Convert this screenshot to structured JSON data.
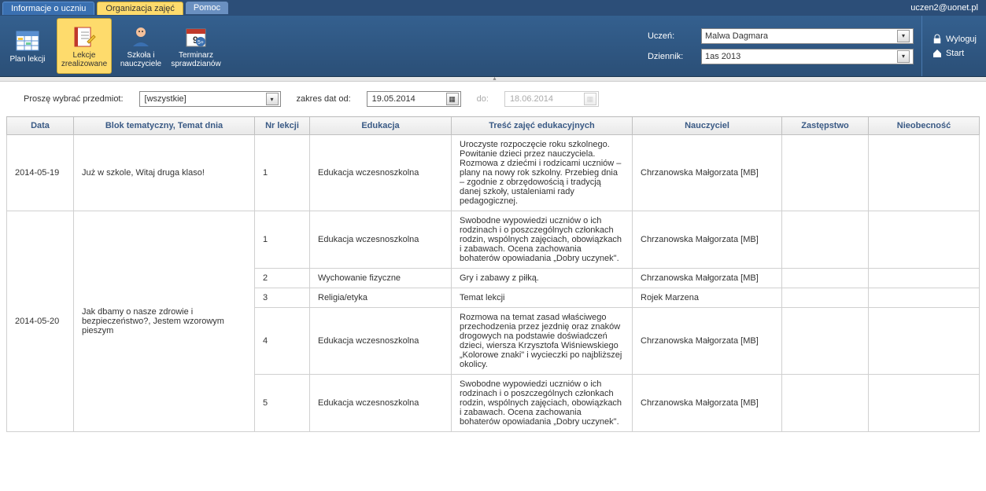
{
  "header": {
    "tabs": [
      "Informacje o uczniu",
      "Organizacja zajęć",
      "Pomoc"
    ],
    "user_email": "uczen2@uonet.pl"
  },
  "ribbon": {
    "buttons": [
      {
        "label": "Plan lekcji"
      },
      {
        "label": "Lekcje zrealizowane"
      },
      {
        "label": "Szkoła i nauczyciele"
      },
      {
        "label": "Terminarz sprawdzianów"
      }
    ],
    "uczen_label": "Uczeń:",
    "uczen_value": "Malwa Dagmara",
    "dziennik_label": "Dziennik:",
    "dziennik_value": "1as 2013",
    "logout": "Wyloguj",
    "start": "Start"
  },
  "filter": {
    "subject_label": "Proszę wybrać przedmiot:",
    "subject_value": "[wszystkie]",
    "date_from_label": "zakres dat od:",
    "date_from_value": "19.05.2014",
    "date_to_label": "do:",
    "date_to_value": "18.06.2014"
  },
  "grid": {
    "headers": [
      "Data",
      "Blok tematyczny, Temat dnia",
      "Nr lekcji",
      "Edukacja",
      "Treść zajęć edukacyjnych",
      "Nauczyciel",
      "Zastępstwo",
      "Nieobecność"
    ],
    "rows": [
      {
        "data": "2014-05-19",
        "blok": "Już w szkole, Witaj druga klaso!",
        "lessons": [
          {
            "nr": "1",
            "edu": "Edukacja wczesnoszkolna",
            "tresc": "Uroczyste rozpoczęcie roku szkolnego. Powitanie dzieci przez nauczyciela. Rozmowa z dziećmi i rodzicami uczniów – plany na nowy rok szkolny. Przebieg dnia – zgodnie z obrzędowością i tradycją danej szkoły, ustaleniami rady pedagogicznej.",
            "naucz": "Chrzanowska Małgorzata [MB]"
          }
        ]
      },
      {
        "data": "2014-05-20",
        "blok": "Jak dbamy o nasze zdrowie i bezpieczeństwo?, Jestem wzorowym pieszym",
        "lessons": [
          {
            "nr": "1",
            "edu": "Edukacja wczesnoszkolna",
            "tresc": "Swobodne wypowiedzi uczniów o ich rodzinach i o poszczególnych członkach rodzin, wspólnych zajęciach, obowiązkach i zabawach. Ocena zachowania bohaterów opowiadania „Dobry uczynek\".",
            "naucz": "Chrzanowska Małgorzata [MB]"
          },
          {
            "nr": "2",
            "edu": "Wychowanie fizyczne",
            "tresc": "Gry i zabawy z piłką.",
            "naucz": "Chrzanowska Małgorzata [MB]"
          },
          {
            "nr": "3",
            "edu": "Religia/etyka",
            "tresc": "Temat lekcji",
            "naucz": "Rojek Marzena"
          },
          {
            "nr": "4",
            "edu": "Edukacja wczesnoszkolna",
            "tresc": "Rozmowa na temat zasad właściwego przechodzenia przez jezdnię oraz znaków drogowych na podstawie doświadczeń dzieci, wiersza Krzysztofa Wiśniewskiego „Kolorowe znaki\" i wycieczki po najbliższej okolicy.",
            "naucz": "Chrzanowska Małgorzata [MB]"
          },
          {
            "nr": "5",
            "edu": "Edukacja wczesnoszkolna",
            "tresc": "Swobodne wypowiedzi uczniów o ich rodzinach i o poszczególnych członkach rodzin, wspólnych zajęciach, obowiązkach i zabawach. Ocena zachowania bohaterów opowiadania „Dobry uczynek\".",
            "naucz": "Chrzanowska Małgorzata [MB]"
          }
        ]
      }
    ]
  }
}
